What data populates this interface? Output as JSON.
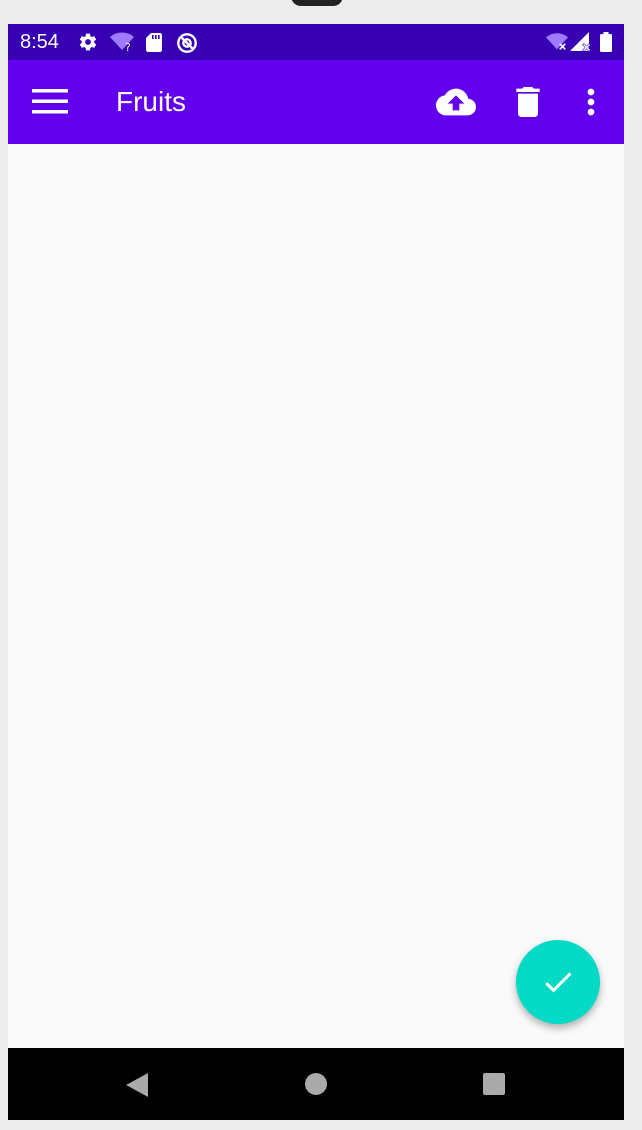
{
  "status_bar": {
    "time": "8:54",
    "icons_left": [
      "settings-icon",
      "wifi-question-icon",
      "sd-card-icon",
      "data-saver-icon"
    ],
    "icons_right": [
      "wifi-off-icon",
      "signal-off-icon",
      "battery-icon"
    ]
  },
  "app_bar": {
    "title": "Fruits",
    "actions": [
      "menu-icon",
      "cloud-upload-icon",
      "delete-icon",
      "more-vert-icon"
    ],
    "color": "#6200ee",
    "status_color": "#3700b3"
  },
  "fab": {
    "icon": "check-icon",
    "color": "#03dac5"
  },
  "nav_bar": {
    "buttons": [
      "back-icon",
      "home-icon",
      "recents-icon"
    ]
  }
}
